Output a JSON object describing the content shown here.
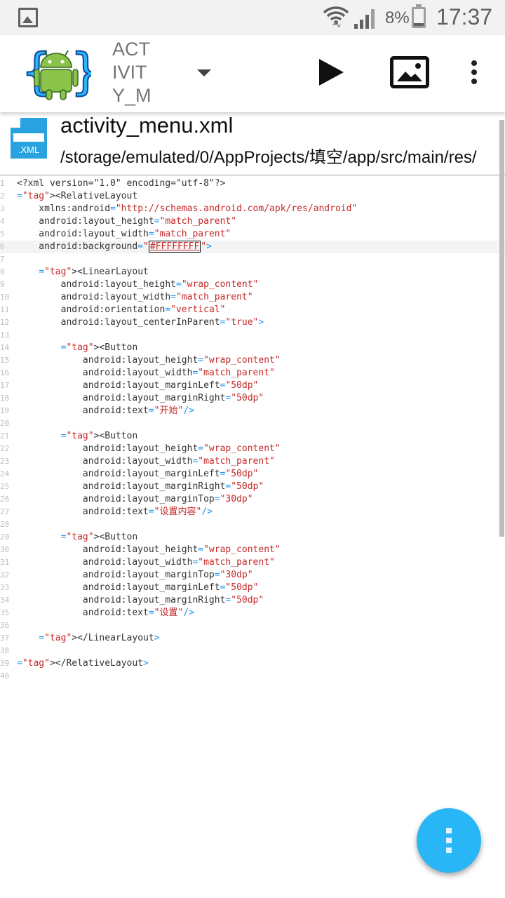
{
  "status_bar": {
    "battery_percent": "8%",
    "time": "17:37"
  },
  "toolbar": {
    "file_selector_label": "ACTIVITY_ME",
    "icons": [
      "android-app-logo-icon",
      "dropdown-arrow-icon",
      "run-icon",
      "design-preview-icon",
      "overflow-menu-icon"
    ]
  },
  "file": {
    "name": "activity_menu.xml",
    "path": "/storage/emulated/0/AppProjects/填空/app/src/main/res/",
    "icon_label": ".XML"
  },
  "editor": {
    "current_line": 6,
    "lines": [
      "<?xml version=\"1.0\" encoding=\"utf-8\"?>",
      "<RelativeLayout",
      "    xmlns:android=\"http://schemas.android.com/apk/res/android\"",
      "    android:layout_height=\"match_parent\"",
      "    android:layout_width=\"match_parent\"",
      "    android:background=\"#FFFFFFFF\">",
      "",
      "    <LinearLayout",
      "        android:layout_height=\"wrap_content\"",
      "        android:layout_width=\"match_parent\"",
      "        android:orientation=\"vertical\"",
      "        android:layout_centerInParent=\"true\">",
      "",
      "        <Button",
      "            android:layout_height=\"wrap_content\"",
      "            android:layout_width=\"match_parent\"",
      "            android:layout_marginLeft=\"50dp\"",
      "            android:layout_marginRight=\"50dp\"",
      "            android:text=\"开始\"/>",
      "",
      "        <Button",
      "            android:layout_height=\"wrap_content\"",
      "            android:layout_width=\"match_parent\"",
      "            android:layout_marginLeft=\"50dp\"",
      "            android:layout_marginRight=\"50dp\"",
      "            android:layout_marginTop=\"30dp\"",
      "            android:text=\"设置内容\"/>",
      "",
      "        <Button",
      "            android:layout_height=\"wrap_content\"",
      "            android:layout_width=\"match_parent\"",
      "            android:layout_marginTop=\"30dp\"",
      "            android:layout_marginLeft=\"50dp\"",
      "            android:layout_marginRight=\"50dp\"",
      "            android:text=\"设置\"/>",
      "",
      "    </LinearLayout>",
      "",
      "</RelativeLayout>",
      ""
    ]
  },
  "colors": {
    "tag": "#2196f3",
    "attribute_value": "#c62828",
    "fab": "#29b6f6"
  },
  "fab": {
    "icon": "more-vert-icon"
  }
}
